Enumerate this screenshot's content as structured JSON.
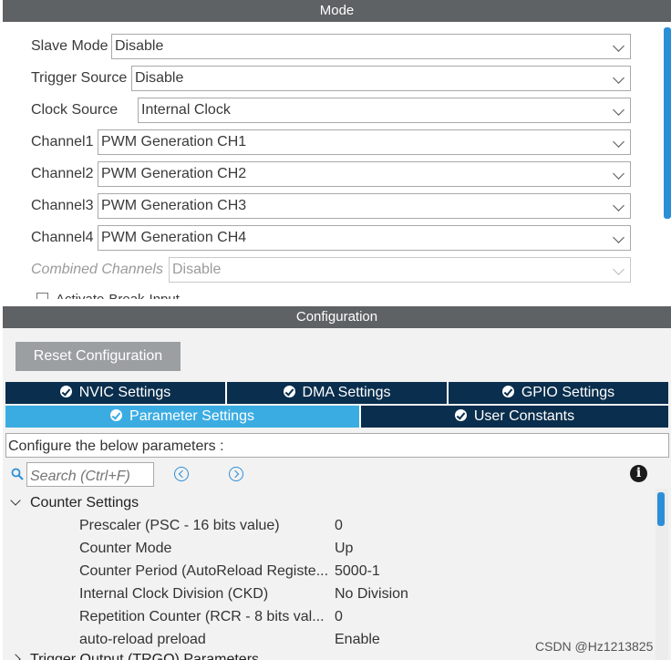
{
  "mode": {
    "title": "Mode",
    "rows": [
      {
        "label": "Slave Mode",
        "value": "Disable"
      },
      {
        "label": "Trigger Source",
        "value": "Disable"
      },
      {
        "label": "Clock Source",
        "value": "Internal Clock"
      },
      {
        "label": "Channel1",
        "value": "PWM Generation CH1"
      },
      {
        "label": "Channel2",
        "value": "PWM Generation CH2"
      },
      {
        "label": "Channel3",
        "value": "PWM Generation CH3"
      },
      {
        "label": "Channel4",
        "value": "PWM Generation CH4"
      },
      {
        "label": "Combined Channels",
        "value": "Disable"
      }
    ],
    "partial_checkbox_label": "Activate-Break-Input"
  },
  "configuration": {
    "title": "Configuration",
    "reset_label": "Reset Configuration",
    "tabs_row1": [
      {
        "label": "NVIC Settings"
      },
      {
        "label": "DMA Settings"
      },
      {
        "label": "GPIO Settings"
      }
    ],
    "tabs_row2": [
      {
        "label": "Parameter Settings",
        "active": true
      },
      {
        "label": "User Constants"
      }
    ],
    "instruction": "Configure the below parameters :",
    "search_placeholder": "Search (Ctrl+F)",
    "sections": [
      {
        "title": "Counter Settings",
        "expanded": true,
        "params": [
          {
            "name": "Prescaler (PSC - 16 bits value)",
            "value": "0"
          },
          {
            "name": "Counter Mode",
            "value": "Up"
          },
          {
            "name": "Counter Period (AutoReload Registe...",
            "value": "5000-1"
          },
          {
            "name": "Internal Clock Division (CKD)",
            "value": "No Division"
          },
          {
            "name": "Repetition Counter (RCR - 8 bits val...",
            "value": "0"
          },
          {
            "name": "auto-reload preload",
            "value": "Enable"
          }
        ]
      },
      {
        "title": "Trigger Output (TRGO) Parameters",
        "expanded": false
      }
    ]
  },
  "watermark": "CSDN @Hz1213825",
  "colors": {
    "header_bg": "#5f6264",
    "tab_dark": "#0a2e4d",
    "tab_active": "#3bace2",
    "accent": "#2d8ed8"
  },
  "icons": {
    "dropdown": "chevron-down-icon",
    "tab_check": "check-circle-icon",
    "search": "search-icon",
    "nav_prev": "chevron-left-circle-icon",
    "nav_next": "chevron-right-circle-icon",
    "info": "info-icon"
  }
}
